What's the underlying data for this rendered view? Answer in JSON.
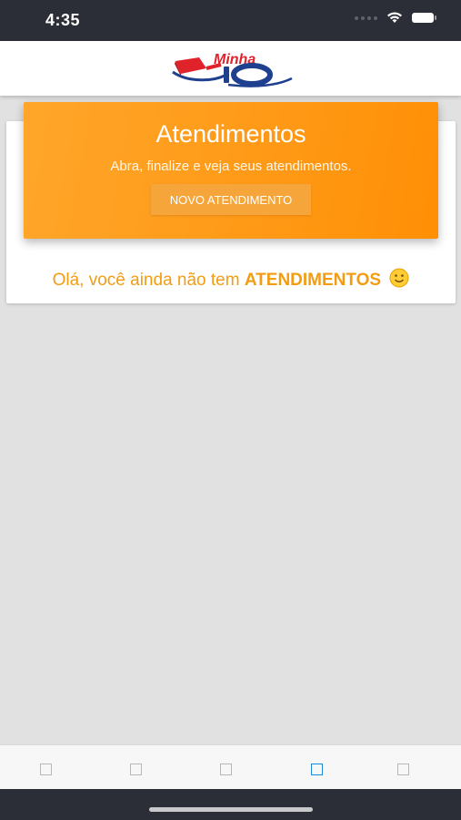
{
  "status_bar": {
    "time": "4:35"
  },
  "header": {
    "logo_text": "Minha IO"
  },
  "banner": {
    "title": "Atendimentos",
    "subtitle": "Abra, finalize e veja seus atendimentos.",
    "button_label": "NOVO ATENDIMENTO"
  },
  "empty_state": {
    "prefix": "Olá, você ainda não tem ",
    "highlight": "ATENDIMENTOS",
    "emoji_icon": "smiley-icon"
  },
  "tab_bar": {
    "tabs": [
      {
        "icon": "tab-placeholder-icon",
        "active": false
      },
      {
        "icon": "tab-placeholder-icon",
        "active": false
      },
      {
        "icon": "tab-placeholder-icon",
        "active": false
      },
      {
        "icon": "tab-placeholder-icon",
        "active": true
      },
      {
        "icon": "tab-placeholder-icon",
        "active": false
      }
    ]
  },
  "colors": {
    "accent": "#ff9a17",
    "message": "#f39c12",
    "status_bar": "#2b2e37",
    "tab_active": "#1a8bd8"
  }
}
